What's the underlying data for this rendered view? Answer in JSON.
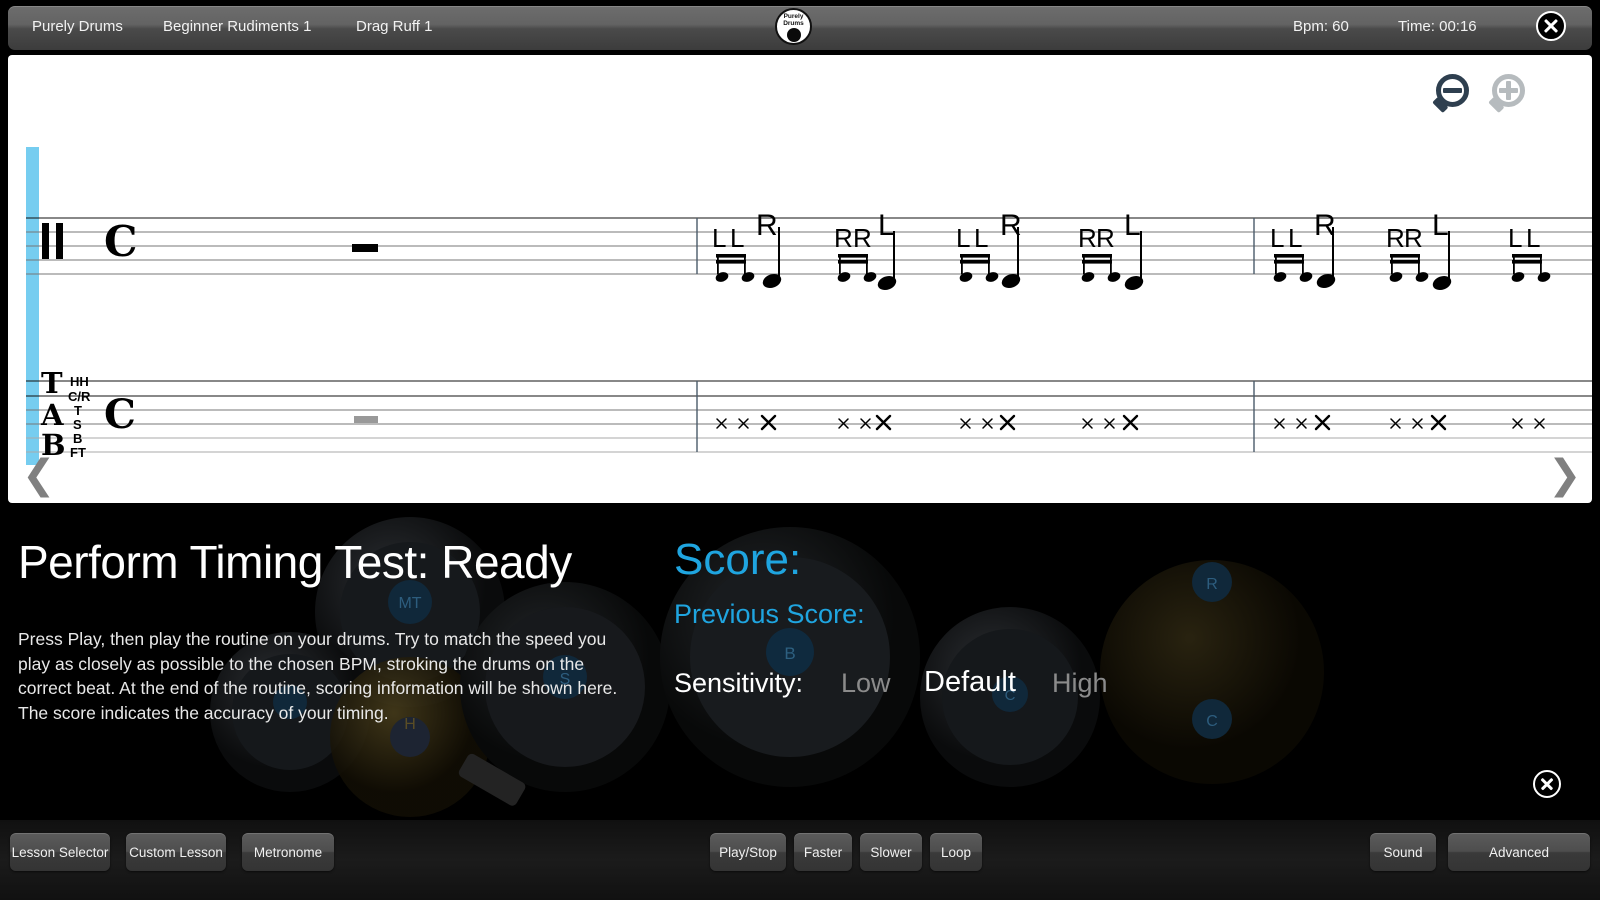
{
  "header": {
    "breadcrumbs": [
      "Purely Drums",
      "Beginner Rudiments 1",
      "Drag Ruff 1"
    ],
    "bpm_label": "Bpm: 60",
    "time_label": "Time: 00:16",
    "logo_text": "Purely\nDrums",
    "close_icon": "close-icon"
  },
  "score_panel": {
    "zoom_out_icon": "zoom-out-icon",
    "zoom_in_icon": "zoom-in-icon",
    "prev_arrow": "❮",
    "next_arrow": "❯",
    "staff_clef": "percussion-clef",
    "time_signature": "C",
    "tab_letters": [
      "T",
      "A",
      "B"
    ],
    "tab_row_labels": [
      "HH",
      "C/R",
      "T",
      "S",
      "B",
      "FT"
    ],
    "rest_symbol": "whole-rest",
    "playhead_color": "#76cdf0",
    "sticking_groups": [
      {
        "grace": [
          "L",
          "L"
        ],
        "main": "R"
      },
      {
        "grace": [
          "R",
          "R"
        ],
        "main": "L"
      },
      {
        "grace": [
          "L",
          "L"
        ],
        "main": "R"
      },
      {
        "grace": [
          "R",
          "R"
        ],
        "main": "L"
      },
      {
        "grace": [
          "L",
          "L"
        ],
        "main": "R"
      },
      {
        "grace": [
          "R",
          "R"
        ],
        "main": "L"
      },
      {
        "grace": [
          "L",
          "L"
        ],
        "main": ""
      }
    ]
  },
  "lower": {
    "perform_title": "Perform Timing Test: Ready",
    "perform_desc": "Press Play, then play the routine on your drums. Try to match the speed you play as closely as possible to the chosen BPM, stroking the drums on the correct beat. At the end of the routine, scoring information will be shown here. The score indicates the accuracy of your timing.",
    "score_label": "Score:",
    "previous_score_label": "Previous Score:",
    "sensitivity_label": "Sensitivity:",
    "sensitivity_options": [
      "Low",
      "Default",
      "High"
    ],
    "sensitivity_selected": "Default",
    "accent_color": "#1fa5e0",
    "close_icon": "close-icon",
    "kit_labels": [
      "MT",
      "B",
      "S",
      "H",
      "R",
      "C"
    ]
  },
  "toolbar": {
    "left_buttons": [
      "Lesson Selector",
      "Custom Lesson",
      "Metronome"
    ],
    "center_buttons": [
      "Play/Stop",
      "Faster",
      "Slower",
      "Loop"
    ],
    "right_buttons": [
      "Sound",
      "Advanced"
    ]
  }
}
